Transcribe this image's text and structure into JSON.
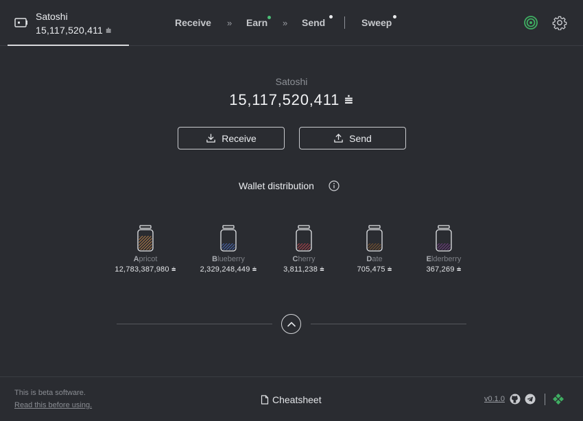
{
  "header": {
    "wallet_name": "Satoshi",
    "wallet_balance": "15,117,520,411 ⩧",
    "nav": {
      "receive": "Receive",
      "earn": "Earn",
      "send": "Send",
      "sweep": "Sweep",
      "separator": "»"
    }
  },
  "main": {
    "wallet_label": "Satoshi",
    "balance": "15,117,520,411 ⩧",
    "receive_button": "Receive",
    "send_button": "Send",
    "distribution_title": "Wallet distribution"
  },
  "jars": [
    {
      "initial": "A",
      "rest": "pricot",
      "amount": "12,783,387,980 ⩧",
      "color": "#c9884a"
    },
    {
      "initial": "B",
      "rest": "lueberry",
      "amount": "2,329,248,449 ⩧",
      "color": "#4c6fc4"
    },
    {
      "initial": "C",
      "rest": "herry",
      "amount": "3,811,238 ⩧",
      "color": "#c2454d"
    },
    {
      "initial": "D",
      "rest": "ate",
      "amount": "705,475 ⩧",
      "color": "#8a5a2e"
    },
    {
      "initial": "E",
      "rest": "lderberry",
      "amount": "367,269 ⩧",
      "color": "#7b3f8c"
    }
  ],
  "footer": {
    "beta_text": "This is beta software.",
    "beta_link": "Read this before using.",
    "cheatsheet": "Cheatsheet",
    "version": "v0.1.0"
  },
  "colors": {
    "background": "#2a2c31",
    "status_green": "#3fae62",
    "earn_dot": "#4bbf77"
  }
}
